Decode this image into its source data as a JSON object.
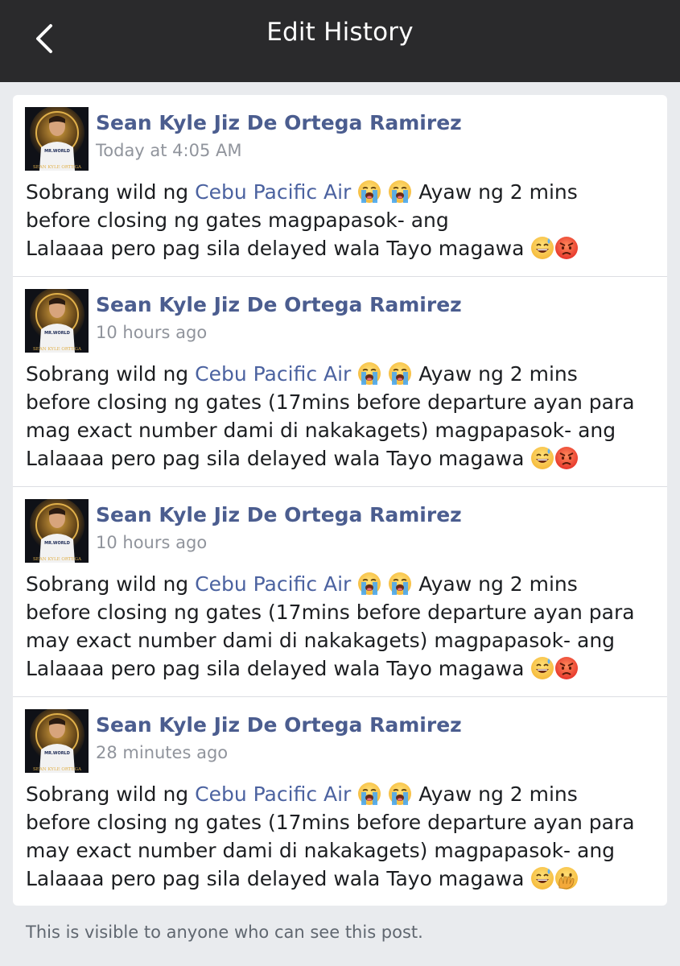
{
  "header": {
    "title": "Edit History",
    "back_icon": "chevron-left-icon"
  },
  "entries": [
    {
      "author": "Sean Kyle Jiz De Ortega Ramirez",
      "time": "Today at 4:05 AM",
      "line1_a": "Sobrang wild ng ",
      "link": "Cebu Pacific Air",
      "line1_b": "Ayaw ng 2 mins",
      "line2": "before closing ng gates magpapasok- ang",
      "line3": "Lalaaaa pero pag sila delayed wala Tayo magawa",
      "end_emojis": [
        "grinning-sweat-emoji",
        "angry-face-emoji"
      ]
    },
    {
      "author": "Sean Kyle Jiz De Ortega Ramirez",
      "time": "10 hours ago",
      "line1_a": "Sobrang wild ng ",
      "link": "Cebu Pacific Air",
      "line1_b": "Ayaw ng 2 mins",
      "line2": "before closing ng gates (17mins before departure ayan para",
      "line3": "mag exact number dami di nakakagets) magpapasok- ang",
      "line4": "Lalaaaa pero pag sila delayed wala Tayo magawa",
      "end_emojis": [
        "grinning-sweat-emoji",
        "angry-face-emoji"
      ]
    },
    {
      "author": "Sean Kyle Jiz De Ortega Ramirez",
      "time": "10 hours ago",
      "line1_a": "Sobrang wild ng ",
      "link": "Cebu Pacific Air",
      "line1_b": "Ayaw ng 2 mins",
      "line2": "before closing ng gates (17mins before departure ayan para",
      "line3": "may exact number dami di nakakagets) magpapasok- ang",
      "line4": "Lalaaaa pero pag sila delayed wala Tayo magawa",
      "end_emojis": [
        "grinning-sweat-emoji",
        "angry-face-emoji"
      ]
    },
    {
      "author": "Sean Kyle Jiz De Ortega Ramirez",
      "time": "28 minutes ago",
      "line1_a": "Sobrang wild ng ",
      "link": "Cebu Pacific Air",
      "line1_b": "Ayaw ng 2 mins",
      "line2": "before closing ng gates (17mins before departure ayan para",
      "line3": "may exact number dami di nakakagets) magpapasok- ang",
      "line4": "Lalaaaa pero pag sila delayed wala Tayo magawa",
      "end_emojis": [
        "grinning-sweat-emoji",
        "face-with-hand-over-mouth-emoji"
      ]
    }
  ],
  "avatar_text": {
    "shirt": "MR.WORLD",
    "name": "SEAN KYLE ORTEGA"
  },
  "footer": {
    "note": "This is visible to anyone who can see this post."
  },
  "colors": {
    "header_bg": "#2a2a2c",
    "page_bg": "#e9ebee",
    "author": "#4b5d8f",
    "link": "#4b62a0",
    "timestamp": "#90949c"
  }
}
